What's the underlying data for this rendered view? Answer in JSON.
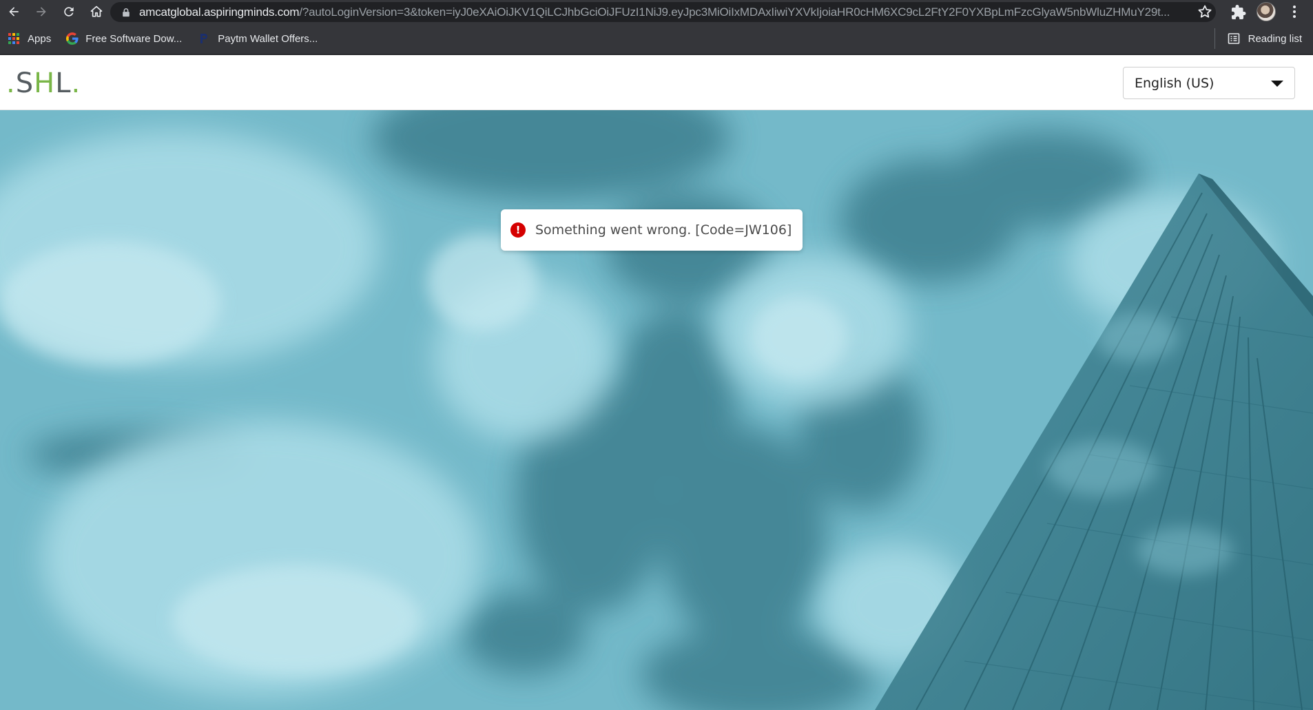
{
  "browser": {
    "url_host": "amcatglobal.aspiringminds.com",
    "url_path": "/?autoLoginVersion=3&token=iyJ0eXAiOiJKV1QiLCJhbGciOiJFUzI1NiJ9.eyJpc3MiOiIxMDAxIiwiYXVkIjoiaHR0cHM6XC9cL2FtY2F0YXBpLmFzcGlyaW5nbWluZHMuY29t...",
    "icons": [
      "back-icon",
      "forward-icon",
      "reload-icon",
      "home-icon",
      "lock-icon",
      "star-icon",
      "extensions-icon",
      "menu-icon"
    ]
  },
  "bookmarks": {
    "items": [
      {
        "label": "Apps",
        "icon": "apps-grid-icon"
      },
      {
        "label": "Free Software Dow...",
        "icon": "google-icon"
      },
      {
        "label": "Paytm Wallet Offers...",
        "icon": "paytm-icon"
      }
    ],
    "reading_list": "Reading list"
  },
  "header": {
    "logo": {
      "dot": ".",
      "s": "S",
      "h": "H",
      "l": "L",
      "end_dot": "."
    },
    "language": {
      "selected": "English (US)"
    }
  },
  "toast": {
    "icon": "error-icon",
    "message": "Something went wrong. [Code=JW106]"
  },
  "colors": {
    "chrome_bg": "#35363a",
    "hero_tint": "#6fb5c6",
    "error_red": "#d50000",
    "logo_green": "#7ab648"
  }
}
